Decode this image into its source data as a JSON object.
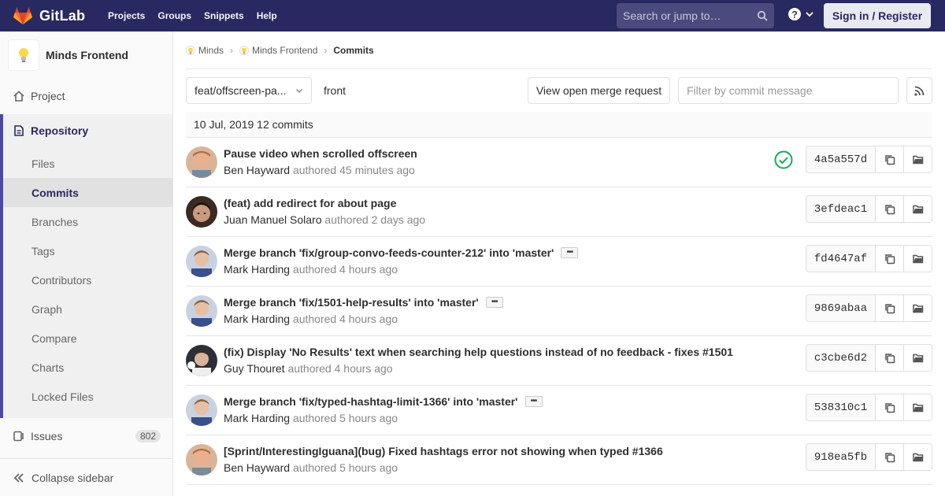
{
  "navbar": {
    "brand": "GitLab",
    "links": [
      "Projects",
      "Groups",
      "Snippets",
      "Help"
    ],
    "search_placeholder": "Search or jump to…",
    "signin_label": "Sign in / Register"
  },
  "sidebar": {
    "project_name": "Minds Frontend",
    "project_label": "Project",
    "repository_label": "Repository",
    "repo_items": [
      "Files",
      "Commits",
      "Branches",
      "Tags",
      "Contributors",
      "Graph",
      "Compare",
      "Charts",
      "Locked Files"
    ],
    "active_item": "Commits",
    "issues_label": "Issues",
    "issues_count": "802",
    "collapse_label": "Collapse sidebar"
  },
  "breadcrumb": {
    "group": "Minds",
    "project": "Minds Frontend",
    "current": "Commits"
  },
  "toolbar": {
    "branch": "feat/offscreen-pa...",
    "path": "front",
    "merge_request_label": "View open merge request",
    "filter_placeholder": "Filter by commit message"
  },
  "day_header": "10 Jul, 2019 12 commits",
  "commits": [
    {
      "title": "Pause video when scrolled offscreen",
      "author": "Ben Hayward",
      "authored": "authored",
      "time": "45 minutes ago",
      "sha": "4a5a557d",
      "has_ellipsis": false,
      "status": "passed"
    },
    {
      "title": "(feat) add redirect for about page",
      "author": "Juan Manuel Solaro",
      "authored": "authored",
      "time": "2 days ago",
      "sha": "3efdeac1",
      "has_ellipsis": false,
      "status": ""
    },
    {
      "title": "Merge branch 'fix/group-convo-feeds-counter-212' into 'master'",
      "author": "Mark Harding",
      "authored": "authored",
      "time": "4 hours ago",
      "sha": "fd4647af",
      "has_ellipsis": true,
      "status": ""
    },
    {
      "title": "Merge branch 'fix/1501-help-results' into 'master'",
      "author": "Mark Harding",
      "authored": "authored",
      "time": "4 hours ago",
      "sha": "9869abaa",
      "has_ellipsis": true,
      "status": ""
    },
    {
      "title": "(fix) Display 'No Results' text when searching help questions instead of no feedback - fixes #1501",
      "author": "Guy Thouret",
      "authored": "authored",
      "time": "4 hours ago",
      "sha": "c3cbe6d2",
      "has_ellipsis": false,
      "status": ""
    },
    {
      "title": "Merge branch 'fix/typed-hashtag-limit-1366' into 'master'",
      "author": "Mark Harding",
      "authored": "authored",
      "time": "5 hours ago",
      "sha": "538310c1",
      "has_ellipsis": true,
      "status": ""
    },
    {
      "title": "[Sprint/InterestingIguana](bug) Fixed hashtags error not showing when typed #1366",
      "author": "Ben Hayward",
      "authored": "authored",
      "time": "5 hours ago",
      "sha": "918ea5fb",
      "has_ellipsis": false,
      "status": ""
    }
  ],
  "colors": {
    "navbar": "#292961",
    "accent": "#4b4ba3",
    "success": "#1aaa55"
  }
}
